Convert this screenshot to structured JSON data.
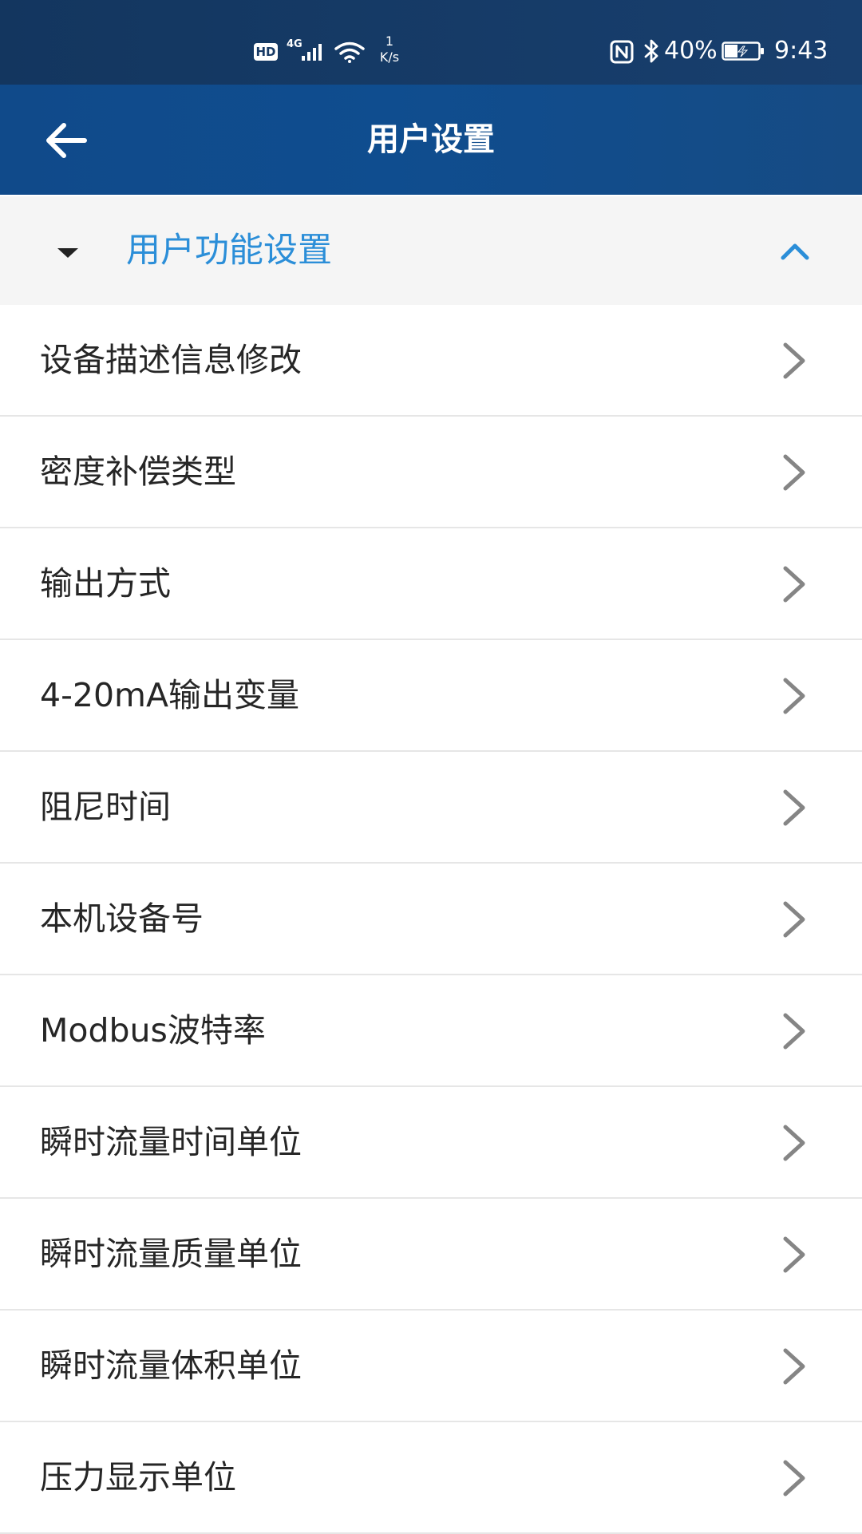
{
  "status_bar": {
    "hd": "HD",
    "network": "4G",
    "speed_value": "1",
    "speed_unit": "K/s",
    "battery_percent": "40%",
    "battery_level": 0.4,
    "time": "9:43",
    "icons": [
      "hd-icon",
      "signal-icon",
      "wifi-icon",
      "nfc-icon",
      "bluetooth-icon",
      "battery-charging-icon"
    ]
  },
  "app_bar": {
    "title": "用户设置",
    "back_icon": "arrow-left-icon",
    "background": "#104a8a"
  },
  "section": {
    "title": "用户功能设置",
    "title_color": "#2b8ed8",
    "expanded": true,
    "expand_icon": "caret-down-icon",
    "collapse_icon": "chevron-up-icon"
  },
  "menu": {
    "chevron_icon": "chevron-right-icon",
    "items": [
      {
        "label": "设备描述信息修改"
      },
      {
        "label": "密度补偿类型"
      },
      {
        "label": "输出方式"
      },
      {
        "label": "4-20mA输出变量"
      },
      {
        "label": "阻尼时间"
      },
      {
        "label": "本机设备号"
      },
      {
        "label": "Modbus波特率"
      },
      {
        "label": "瞬时流量时间单位"
      },
      {
        "label": "瞬时流量质量单位"
      },
      {
        "label": "瞬时流量体积单位"
      },
      {
        "label": "压力显示单位"
      }
    ]
  }
}
